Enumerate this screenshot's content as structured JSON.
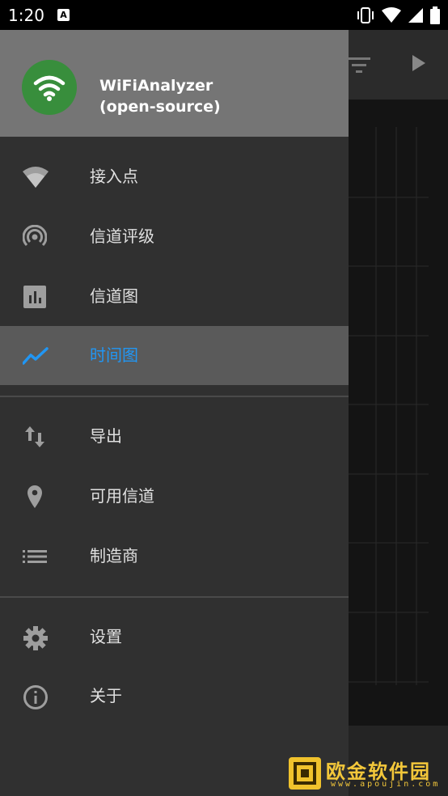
{
  "status_bar": {
    "time": "1:20",
    "notification_badge": "A",
    "icons": [
      "vibrate-icon",
      "wifi-icon",
      "signal-icon",
      "battery-icon"
    ]
  },
  "drawer": {
    "app_name_line1": "WiFiAnalyzer",
    "app_name_line2": "(open-source)",
    "logo_color": "#388e3c",
    "accent_color": "#2196f3",
    "groups": [
      [
        {
          "id": "access-points",
          "label": "接入点",
          "icon": "wifi-icon",
          "selected": false
        },
        {
          "id": "channel-rating",
          "label": "信道评级",
          "icon": "radar-icon",
          "selected": false
        },
        {
          "id": "channel-graph",
          "label": "信道图",
          "icon": "bar-chart-icon",
          "selected": false
        },
        {
          "id": "time-graph",
          "label": "时间图",
          "icon": "line-chart-icon",
          "selected": true
        }
      ],
      [
        {
          "id": "export",
          "label": "导出",
          "icon": "swap-vert-icon",
          "selected": false
        },
        {
          "id": "available-channels",
          "label": "可用信道",
          "icon": "location-pin-icon",
          "selected": false
        },
        {
          "id": "vendors",
          "label": "制造商",
          "icon": "list-icon",
          "selected": false
        }
      ],
      [
        {
          "id": "settings",
          "label": "设置",
          "icon": "gear-icon",
          "selected": false
        },
        {
          "id": "about",
          "label": "关于",
          "icon": "info-icon",
          "selected": false
        }
      ]
    ]
  },
  "watermark": {
    "text": "欧金软件园",
    "url": "www.apoujin.com"
  }
}
